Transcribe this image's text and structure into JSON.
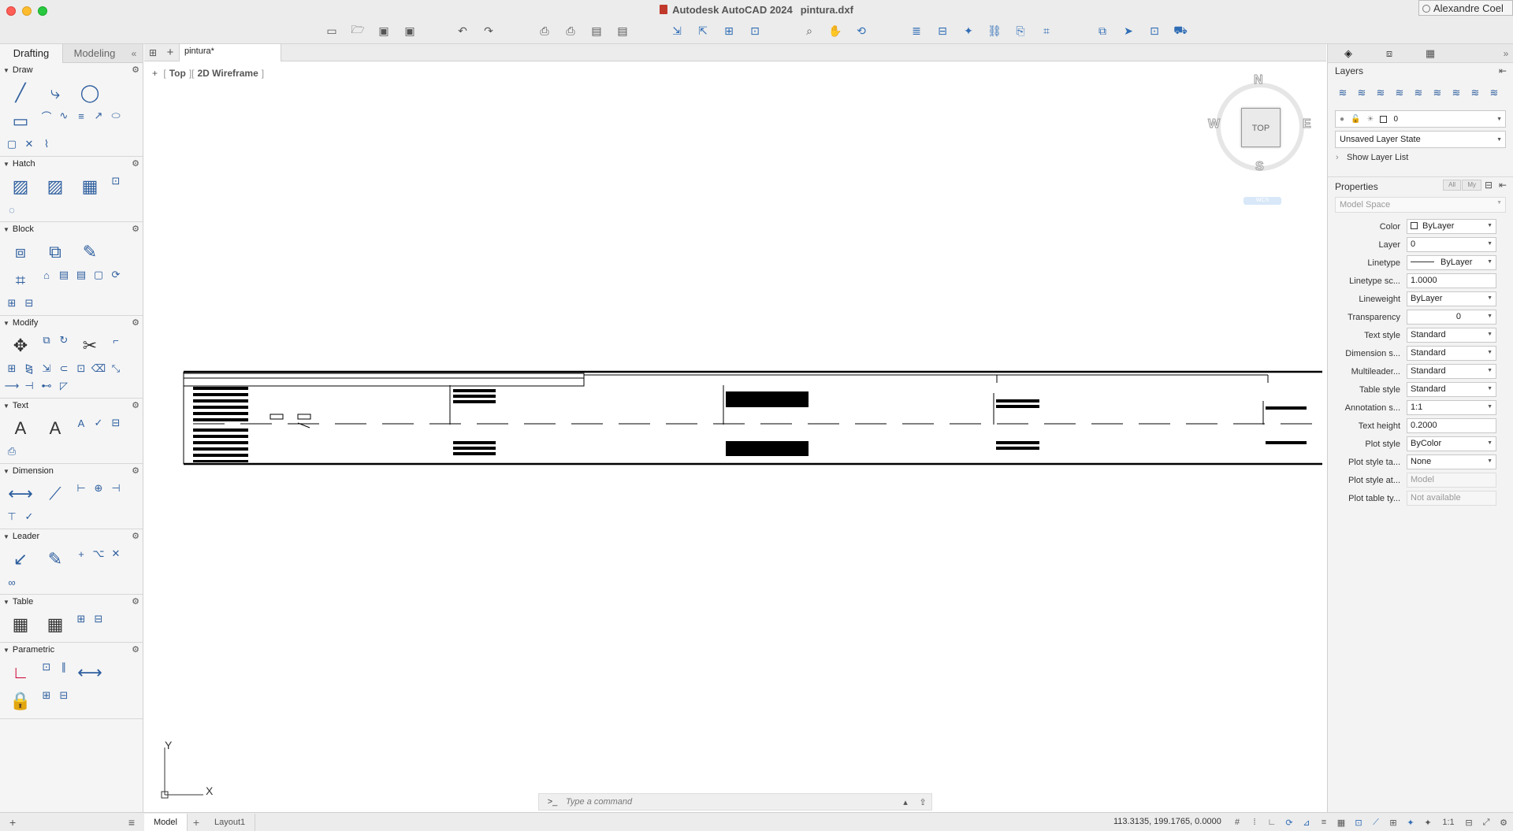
{
  "window": {
    "app_title": "Autodesk AutoCAD 2024",
    "file_name": "pintura.dxf",
    "user": "Alexandre Coel"
  },
  "quick_access": {
    "icons": [
      "new-icon",
      "open-icon",
      "save-icon",
      "save-as-icon",
      "undo-icon",
      "redo-icon",
      "plot-icon",
      "batch-plot-icon",
      "publish-icon",
      "publish-dwf-icon",
      "import-icon",
      "export-icon",
      "attach-icon",
      "share-icon",
      "zoom-icon",
      "pan-icon",
      "orbit-icon",
      "layer-properties-icon",
      "block-editor-icon",
      "match-properties-icon",
      "xref-icon",
      "attribute-icon",
      "quickcalc-icon",
      "compare-icon",
      "send-icon",
      "app-store-icon",
      "connect-icon"
    ]
  },
  "palette": {
    "tabs": [
      "Drafting",
      "Modeling"
    ],
    "active_tab": "Drafting",
    "sections": {
      "draw": "Draw",
      "hatch": "Hatch",
      "block": "Block",
      "modify": "Modify",
      "text": "Text",
      "dimension": "Dimension",
      "leader": "Leader",
      "table": "Table",
      "parametric": "Parametric"
    }
  },
  "doc_tab": "pintura*",
  "viewport": {
    "view": "Top",
    "visual_style": "2D Wireframe",
    "viewcube": {
      "face": "TOP",
      "n": "N",
      "s": "S",
      "e": "E",
      "w": "W"
    },
    "wcs_label": "WCS",
    "ucs": {
      "x": "X",
      "y": "Y"
    }
  },
  "command": {
    "prompt": ">_",
    "placeholder": "Type a command"
  },
  "layout_tabs": [
    "Model",
    "Layout1"
  ],
  "active_layout": "Model",
  "status": {
    "coordinates": "113.3135, 199.1765, 0.0000",
    "scale": "1:1"
  },
  "layers_panel": {
    "title": "Layers",
    "current_layer": "0",
    "layer_state": "Unsaved Layer State",
    "show_list": "Show Layer List"
  },
  "properties_panel": {
    "title": "Properties",
    "filter_all": "All",
    "filter_my": "My",
    "space": "Model Space",
    "rows": [
      {
        "label": "Color",
        "value": "ByLayer",
        "kind": "color"
      },
      {
        "label": "Layer",
        "value": "0",
        "kind": "combo"
      },
      {
        "label": "Linetype",
        "value": "ByLayer",
        "kind": "linetype"
      },
      {
        "label": "Linetype sc...",
        "value": "1.0000",
        "kind": "text"
      },
      {
        "label": "Lineweight",
        "value": "ByLayer",
        "kind": "combo"
      },
      {
        "label": "Transparency",
        "value": "0",
        "kind": "transparency"
      },
      {
        "label": "Text style",
        "value": "Standard",
        "kind": "combo"
      },
      {
        "label": "Dimension s...",
        "value": "Standard",
        "kind": "combo"
      },
      {
        "label": "Multileader...",
        "value": "Standard",
        "kind": "combo"
      },
      {
        "label": "Table style",
        "value": "Standard",
        "kind": "combo"
      },
      {
        "label": "Annotation s...",
        "value": "1:1",
        "kind": "combo"
      },
      {
        "label": "Text height",
        "value": "0.2000",
        "kind": "text"
      },
      {
        "label": "Plot style",
        "value": "ByColor",
        "kind": "combo"
      },
      {
        "label": "Plot style ta...",
        "value": "None",
        "kind": "combo"
      },
      {
        "label": "Plot style at...",
        "value": "Model",
        "kind": "disabled"
      },
      {
        "label": "Plot table ty...",
        "value": "Not available",
        "kind": "disabled"
      }
    ]
  }
}
